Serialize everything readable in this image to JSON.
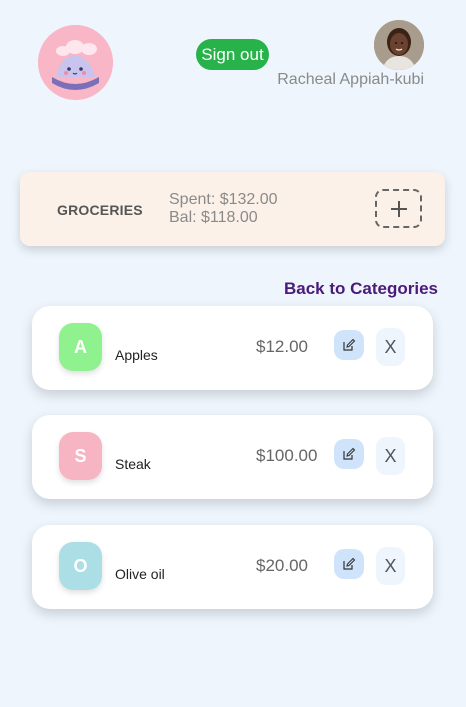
{
  "header": {
    "signout_label": "Sign out",
    "username": "Racheal Appiah-kubi"
  },
  "category": {
    "name": "GROCERIES",
    "spent": "Spent: $132.00",
    "balance": "Bal: $118.00",
    "add_icon": "plus-icon"
  },
  "back_link": "Back to Categories",
  "items": [
    {
      "initial": "A",
      "name": "Apples",
      "price": "$12.00",
      "color": "#8ff28f",
      "delete_label": "X"
    },
    {
      "initial": "S",
      "name": "Steak",
      "price": "$100.00",
      "color": "#f7b5c4",
      "delete_label": "X"
    },
    {
      "initial": "O",
      "name": "Olive oil",
      "price": "$20.00",
      "color": "#acdee6",
      "delete_label": "X"
    }
  ],
  "colors": {
    "background": "#eef5fd",
    "signout": "#27b24a",
    "back_link": "#4c1a7a",
    "category_card": "#fbf1e8",
    "edit_button": "#cfe4fb"
  }
}
